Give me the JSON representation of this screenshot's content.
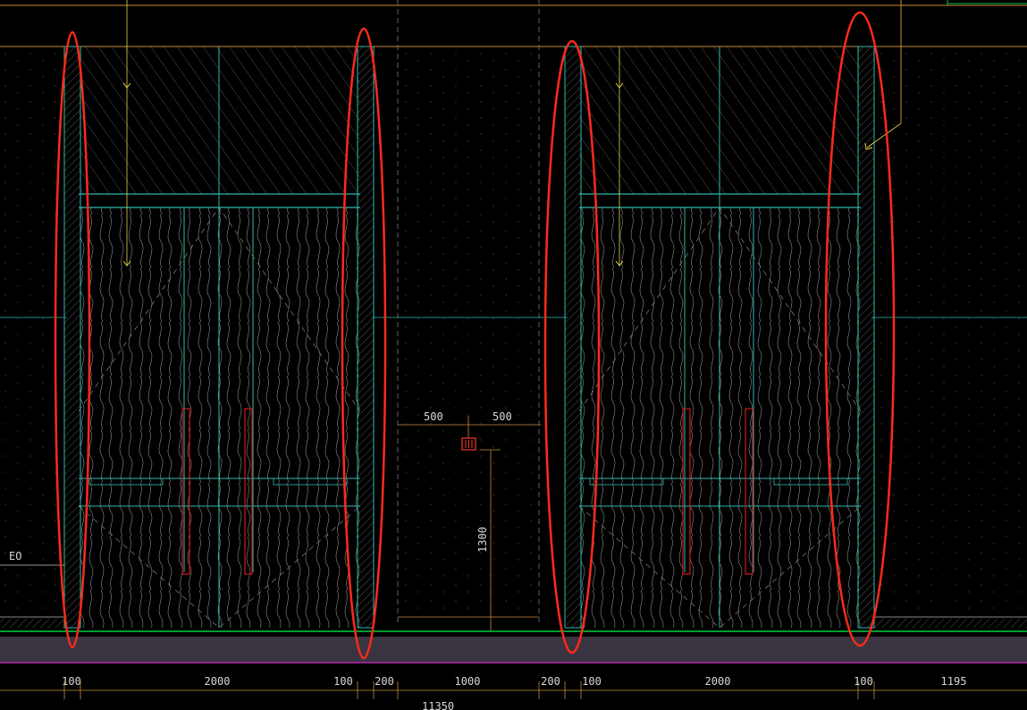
{
  "colors": {
    "background": "#000000",
    "frame": "#2fb8b0",
    "hatch": "#7a7a7a",
    "grain": "#9a9a9a",
    "dimension": "#c88a3a",
    "leader": "#e8d24a",
    "highlight": "#ff2a1a",
    "floor_band": "#3a3440",
    "floor_line": "#00d040",
    "floor_under": "#c030c0",
    "door_pull": "#d01818",
    "dim_text": "#d8d8d8"
  },
  "icons": [
    "outlet-icon",
    "arrow-down-icon",
    "leader-arrow-icon"
  ],
  "labels": {
    "left_tag": "EO",
    "gap_left": "500",
    "gap_right": "500",
    "outlet_height": "1300",
    "overall": "11350"
  },
  "bottom_dims": [
    "100",
    "2000",
    "100",
    "200",
    "1000",
    "200",
    "100",
    "2000",
    "100",
    "1195"
  ]
}
